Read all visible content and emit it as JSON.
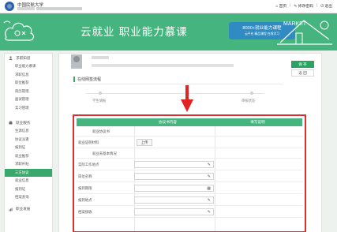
{
  "topbar": {
    "university": "中国民航大学",
    "links": [
      {
        "icon": "home-icon",
        "label": "首页"
      },
      {
        "icon": "edit-icon",
        "label": "修改密码"
      },
      {
        "icon": "power-icon",
        "label": "退出"
      }
    ]
  },
  "banner": {
    "title": "云就业 职业能力慕课",
    "badge_line1": "8000+就业能力课程",
    "badge_line2": "云平台 精品课程 在线学习",
    "right_sign": "MARKET"
  },
  "sidebar": {
    "sections": [
      {
        "title": "求职知道",
        "icon": "user-icon",
        "items": [
          "职业能力慕课",
          "求职信息",
          "职位推荐",
          "简历管理",
          "面试管理",
          "实习管理"
        ]
      },
      {
        "title": "就业服务",
        "icon": "briefcase-icon",
        "items": [
          "生源信息",
          "协议派遣",
          "报到证",
          "就业推荐",
          "求职补贴",
          "三方协议",
          "就业信息",
          "报到证",
          "档案查询"
        ],
        "active_index": 5
      },
      {
        "title": "职业发展",
        "icon": "chart-icon",
        "items": []
      }
    ]
  },
  "actions": {
    "save": "保 存",
    "back": "返 回"
  },
  "process": {
    "header": "在线网签流程",
    "steps": [
      "学生填报",
      "审核状态"
    ]
  },
  "form": {
    "col_headers": [
      "",
      "协议书内容",
      "填写说明"
    ],
    "sub_title_1": "就业协议书",
    "sub_title_2": "就业去基本情况",
    "upload_label": "就业证明材料",
    "upload_button": "上传",
    "fields": [
      {
        "label": "实际工作地点",
        "icon": "pencil-icon",
        "icon_glyph": "✎"
      },
      {
        "label": "岗位名称",
        "icon": "pencil-icon",
        "icon_glyph": "✎"
      },
      {
        "label": "报到期限",
        "icon": "calendar-icon",
        "icon_glyph": "▦"
      },
      {
        "label": "报到地点",
        "icon": "pencil-icon",
        "icon_glyph": "✎"
      },
      {
        "label": "档案接收",
        "icon": "pencil-icon",
        "icon_glyph": "✎"
      }
    ]
  }
}
